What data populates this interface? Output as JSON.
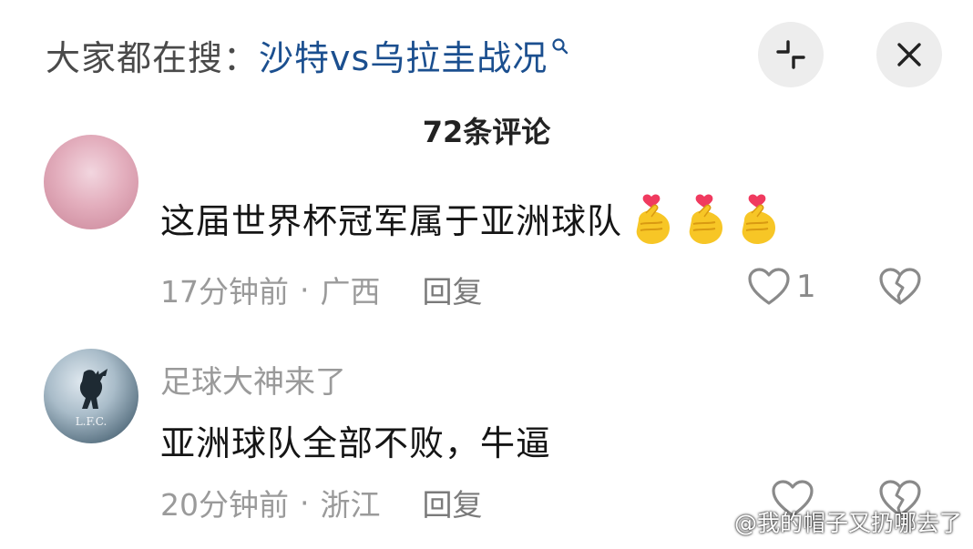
{
  "header": {
    "search_prefix": "大家都在搜：",
    "search_query": "沙特vs乌拉圭战况",
    "collapse_icon": "collapse-icon",
    "close_icon": "close-icon"
  },
  "comments_title": "72条评论",
  "comments": [
    {
      "text": "这届世界杯冠军属于亚洲球队",
      "emoji": "finger-heart-emoji",
      "time": "17分钟前",
      "separator": "·",
      "location": "广西",
      "reply_label": "回复",
      "likes": "1"
    },
    {
      "username": "足球大神来了",
      "avatar_text": "L.F.C.",
      "text": "亚洲球队全部不败，牛逼",
      "time": "20分钟前",
      "separator": "·",
      "location": "浙江",
      "reply_label": "回复",
      "likes": ""
    }
  ],
  "watermark": {
    "text": "@我的帽子又扔哪去了",
    "icon": "weibo-icon"
  },
  "colors": {
    "link": "#1b4f8f",
    "meta": "#9a9a9a",
    "button_bg": "#ededed"
  }
}
